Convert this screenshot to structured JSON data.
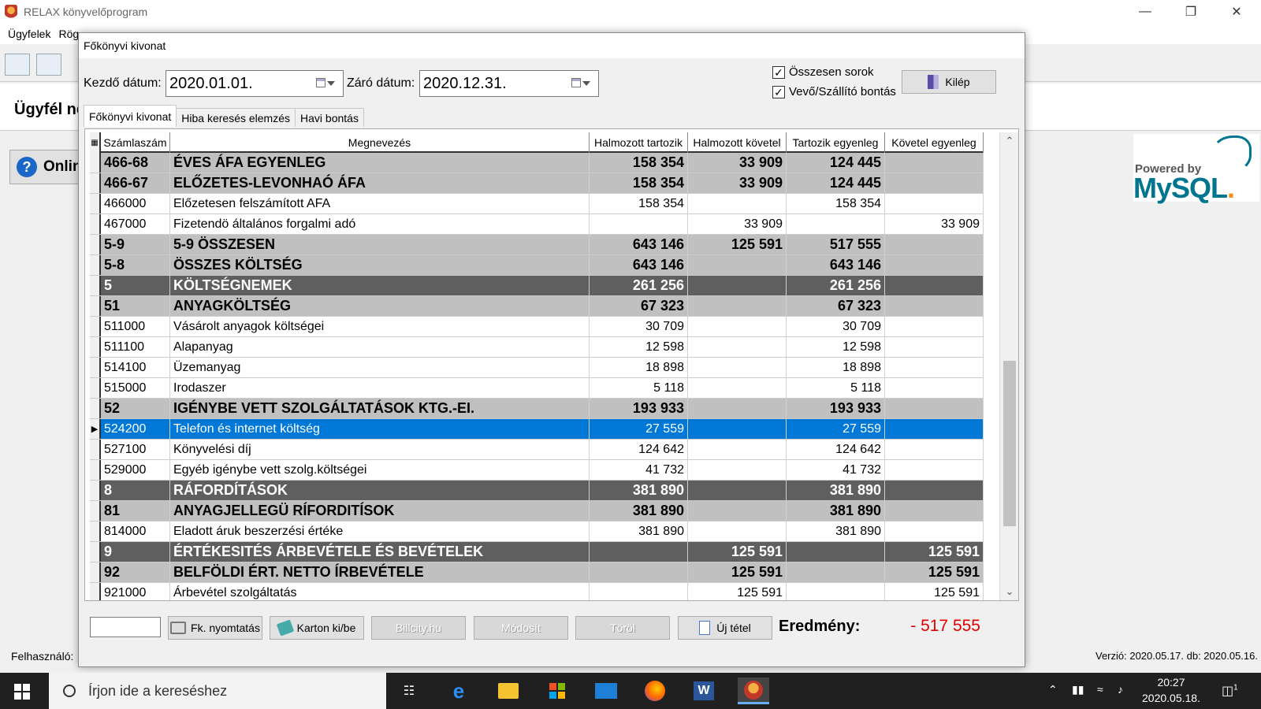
{
  "app": {
    "title": "RELAX könyvelőprogram",
    "menu": [
      "Ügyfelek",
      "Rög"
    ],
    "client_label": "Ügyfél ne",
    "online_label": "Onlin",
    "mysql_small": "Powered by",
    "mysql_big_a": "MySQL",
    "mysql_big_b": ".",
    "user_label": "Felhasználó:",
    "version": "Verzió: 2020.05.17. db: 2020.05.16."
  },
  "dialog": {
    "title": "Főkönyvi kivonat",
    "start_label": "Kezdő dátum:",
    "start_value": "2020.01.01.",
    "end_label": "Záró dátum:",
    "end_value": "2020.12.31.",
    "chk_total_label": "Összesen sorok",
    "chk_total_checked": true,
    "chk_split_label": "Vevő/Szállító bontás",
    "chk_split_checked": true,
    "exit_label": "Kilép",
    "tabs": [
      "Főkönyvi kivonat",
      "Hiba keresés elemzés",
      "Havi bontás"
    ],
    "columns": [
      "Számlaszám",
      "Megnevezés",
      "Halmozott tartozik",
      "Halmozott követel",
      "Tartozik egyenleg",
      "Követel egyenleg"
    ],
    "rows": [
      {
        "type": "sub",
        "code": "466-68",
        "name": "ÉVES ÁFA EGYENLEG",
        "c1": "158 354",
        "c2": "33 909",
        "c3": "124 445",
        "c4": ""
      },
      {
        "type": "sub",
        "code": "466-67",
        "name": "ELŐZETES-LEVONHAÓ ÁFA",
        "c1": "158 354",
        "c2": "33 909",
        "c3": "124 445",
        "c4": ""
      },
      {
        "type": "normal",
        "code": "466000",
        "name": "Előzetesen felszámított AFA",
        "c1": "158 354",
        "c2": "",
        "c3": "158 354",
        "c4": ""
      },
      {
        "type": "normal",
        "code": "467000",
        "name": "Fizetendö általános forgalmi adó",
        "c1": "",
        "c2": "33 909",
        "c3": "",
        "c4": "33 909"
      },
      {
        "type": "sub",
        "code": "5-9",
        "name": "5-9 ÖSSZESEN",
        "c1": "643 146",
        "c2": "125 591",
        "c3": "517 555",
        "c4": ""
      },
      {
        "type": "sub",
        "code": "5-8",
        "name": "ÖSSZES KÖLTSÉG",
        "c1": "643 146",
        "c2": "",
        "c3": "643 146",
        "c4": ""
      },
      {
        "type": "grp",
        "code": "5",
        "name": "KÖLTSÉGNEMEK",
        "c1": "261 256",
        "c2": "",
        "c3": "261 256",
        "c4": ""
      },
      {
        "type": "sub",
        "code": "51",
        "name": "ANYAGKÖLTSÉG",
        "c1": "67 323",
        "c2": "",
        "c3": "67 323",
        "c4": ""
      },
      {
        "type": "normal",
        "code": "511000",
        "name": "Vásárolt anyagok költségei",
        "c1": "30 709",
        "c2": "",
        "c3": "30 709",
        "c4": ""
      },
      {
        "type": "normal",
        "code": "511100",
        "name": "Alapanyag",
        "c1": "12 598",
        "c2": "",
        "c3": "12 598",
        "c4": ""
      },
      {
        "type": "normal",
        "code": "514100",
        "name": "Üzemanyag",
        "c1": "18 898",
        "c2": "",
        "c3": "18 898",
        "c4": ""
      },
      {
        "type": "normal",
        "code": "515000",
        "name": "Irodaszer",
        "c1": "5 118",
        "c2": "",
        "c3": "5 118",
        "c4": ""
      },
      {
        "type": "sub",
        "code": "52",
        "name": "IGÉNYBE VETT SZOLGÁLTATÁSOK KTG.-EI.",
        "c1": "193 933",
        "c2": "",
        "c3": "193 933",
        "c4": ""
      },
      {
        "type": "sel",
        "code": "524200",
        "name": "Telefon és internet költség",
        "c1": "27 559",
        "c2": "",
        "c3": "27 559",
        "c4": ""
      },
      {
        "type": "normal",
        "code": "527100",
        "name": "Könyvelési díj",
        "c1": "124 642",
        "c2": "",
        "c3": "124 642",
        "c4": ""
      },
      {
        "type": "normal",
        "code": "529000",
        "name": "Egyéb igénybe vett szolg.költségei",
        "c1": "41 732",
        "c2": "",
        "c3": "41 732",
        "c4": ""
      },
      {
        "type": "grp",
        "code": "8",
        "name": "RÁFORDÍTÁSOK",
        "c1": "381 890",
        "c2": "",
        "c3": "381 890",
        "c4": ""
      },
      {
        "type": "sub",
        "code": "81",
        "name": "ANYAGJELLEGÜ RÍFORDITÍSOK",
        "c1": "381 890",
        "c2": "",
        "c3": "381 890",
        "c4": ""
      },
      {
        "type": "normal",
        "code": "814000",
        "name": "Eladott áruk beszerzési értéke",
        "c1": "381 890",
        "c2": "",
        "c3": "381 890",
        "c4": ""
      },
      {
        "type": "grp",
        "code": "9",
        "name": "ÉRTÉKESITÉS ÁRBEVÉTELE ÉS BEVÉTELEK",
        "c1": "",
        "c2": "125 591",
        "c3": "",
        "c4": "125 591"
      },
      {
        "type": "sub",
        "code": "92",
        "name": "BELFÖLDI ÉRT. NETTO ÍRBEVÉTELE",
        "c1": "",
        "c2": "125 591",
        "c3": "",
        "c4": "125 591"
      },
      {
        "type": "normal",
        "code": "921000",
        "name": "Árbevétel szolgáltatás",
        "c1": "",
        "c2": "125 591",
        "c3": "",
        "c4": "125 591"
      }
    ],
    "buttons": {
      "print": "Fk. nyomtatás",
      "card": "Karton ki/be",
      "billcity": "Billcity.hu",
      "modify": "Módosít",
      "delete": "Töröl",
      "new_item": "Új tétel"
    },
    "result_label": "Eredmény:",
    "result_value": "- 517 555"
  },
  "taskbar": {
    "search_placeholder": "Írjon ide a kereséshez",
    "time": "20:27",
    "date": "2020.05.18.",
    "notification_count": "1"
  }
}
